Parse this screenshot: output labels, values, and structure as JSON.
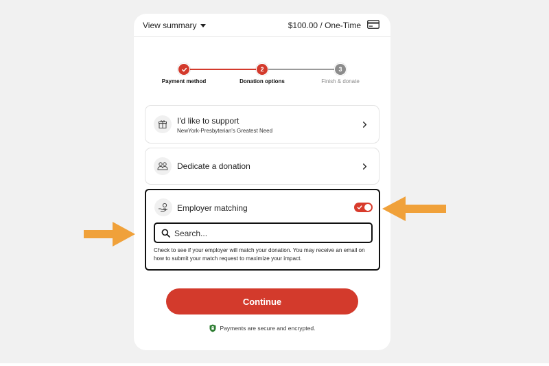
{
  "summary": {
    "toggle_label": "View summary",
    "amount": "$100.00 / One-Time"
  },
  "stepper": {
    "steps": [
      {
        "label": "Payment method",
        "number": "",
        "state": "complete"
      },
      {
        "label": "Donation options",
        "number": "2",
        "state": "current"
      },
      {
        "label": "Finish & donate",
        "number": "3",
        "state": "upcoming"
      }
    ]
  },
  "options": [
    {
      "title": "I'd like to support",
      "subtitle": "NewYork-Presbyterian's Greatest Need",
      "icon": "gift-icon"
    },
    {
      "title": "Dedicate a donation",
      "subtitle": "",
      "icon": "people-icon"
    }
  ],
  "employer": {
    "title": "Employer matching",
    "icon": "hand-coin-icon",
    "toggle_on": true,
    "search_placeholder": "Search...",
    "help_text": "Check to see if your employer will match your donation. You may receive an email on how to submit your match request to maximize your impact."
  },
  "continue_label": "Continue",
  "secure_text": "Payments are secure and encrypted.",
  "colors": {
    "accent": "#d33a2c",
    "upcoming": "#8c8c8c",
    "annotation_arrow": "#f0a13a",
    "secure_shield": "#2e7d32"
  }
}
